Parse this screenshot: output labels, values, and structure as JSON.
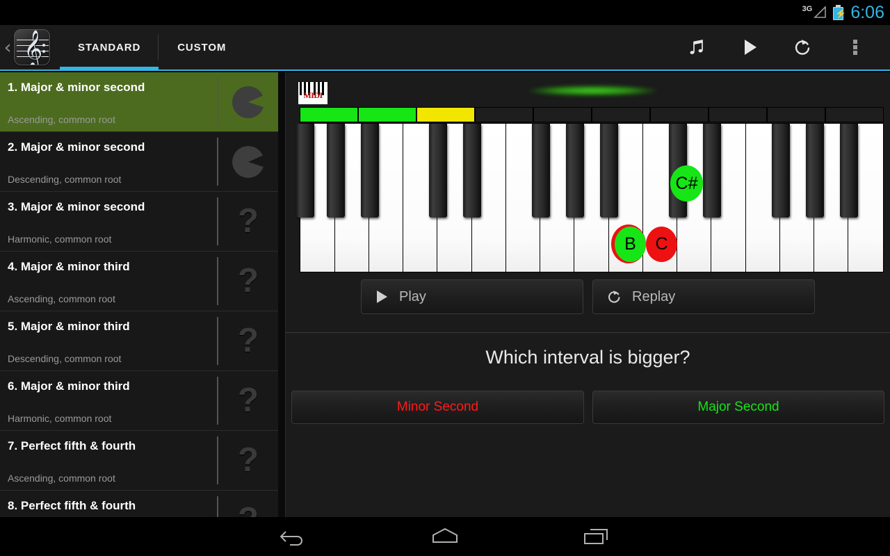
{
  "statusbar": {
    "network_label": "3G",
    "clock": "6:06",
    "signal_icon": "signal-triangle-icon",
    "battery_icon": "battery-charging-icon",
    "accent_color": "#33b5e5"
  },
  "actionbar": {
    "back_chevron": "‹",
    "app_logo_icon": "treble-clef-logo-icon",
    "tabs": [
      {
        "label": "STANDARD",
        "active": true
      },
      {
        "label": "CUSTOM",
        "active": false
      }
    ],
    "actions": [
      {
        "name": "music-note-icon",
        "label": "Notes"
      },
      {
        "name": "play-icon",
        "label": "Play"
      },
      {
        "name": "replay-icon",
        "label": "Replay"
      },
      {
        "name": "overflow-menu-icon",
        "label": "More options"
      }
    ],
    "indicator_color": "#33b5e5"
  },
  "exercise_list": {
    "selected_index": 0,
    "selected_color": "#4c6b1f",
    "items": [
      {
        "title": "1. Major & minor second",
        "subtitle": "Ascending, common root",
        "icon": "pie-progress-icon"
      },
      {
        "title": "2. Major & minor second",
        "subtitle": "Descending, common root",
        "icon": "pie-progress-icon"
      },
      {
        "title": "3. Major & minor second",
        "subtitle": "Harmonic, common root",
        "icon": "question-mark-icon"
      },
      {
        "title": "4. Major & minor third",
        "subtitle": "Ascending, common root",
        "icon": "question-mark-icon"
      },
      {
        "title": "5. Major & minor third",
        "subtitle": "Descending, common root",
        "icon": "question-mark-icon"
      },
      {
        "title": "6. Major & minor third",
        "subtitle": "Harmonic, common root",
        "icon": "question-mark-icon"
      },
      {
        "title": "7. Perfect fifth & fourth",
        "subtitle": "Ascending, common root",
        "icon": "question-mark-icon"
      },
      {
        "title": "8. Perfect fifth & fourth",
        "subtitle": "",
        "icon": "question-mark-icon"
      }
    ]
  },
  "detail": {
    "midi_badge": "MIDI",
    "progress_segments": [
      "green",
      "green",
      "yellow",
      "empty",
      "empty",
      "empty",
      "empty",
      "empty",
      "empty",
      "empty"
    ],
    "segment_colors": {
      "green": "#16e516",
      "yellow": "#f2e600",
      "empty": "#1e1e1e"
    },
    "keyboard_notes": [
      {
        "label": "B",
        "color": "green",
        "ring": "red",
        "key": "white"
      },
      {
        "label": "C",
        "color": "red",
        "ring": "",
        "key": "white"
      },
      {
        "label": "C#",
        "color": "green",
        "ring": "",
        "key": "black"
      }
    ],
    "controls": [
      {
        "label": "Play",
        "icon": "play-icon"
      },
      {
        "label": "Replay",
        "icon": "replay-icon"
      }
    ],
    "question": "Which interval is bigger?",
    "answers": [
      {
        "label": "Minor Second",
        "color": "#ff1a1a"
      },
      {
        "label": "Major Second",
        "color": "#16e516"
      }
    ]
  },
  "navbar": {
    "buttons": [
      {
        "name": "nav-back-icon",
        "label": "Back"
      },
      {
        "name": "nav-home-icon",
        "label": "Home"
      },
      {
        "name": "nav-recents-icon",
        "label": "Recents"
      }
    ]
  }
}
